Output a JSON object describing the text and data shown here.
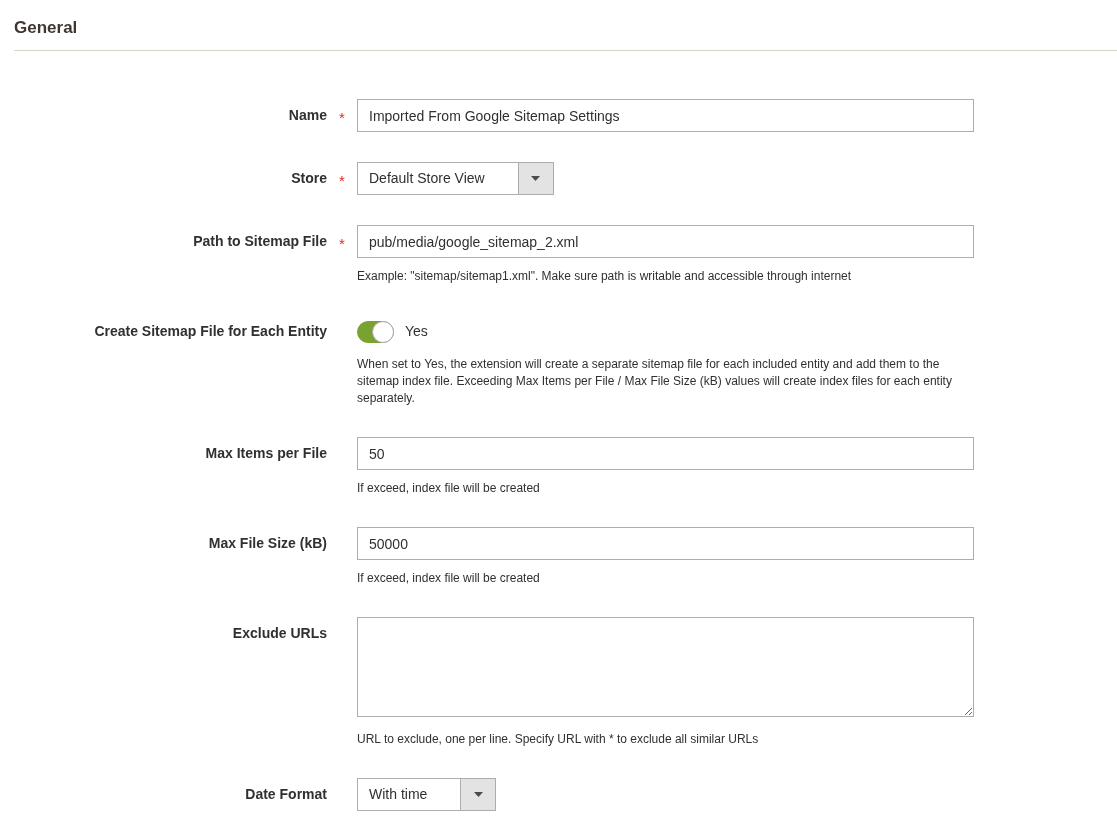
{
  "section": {
    "title": "General"
  },
  "fields": [
    {
      "kind": "text",
      "label": "Name",
      "required_mark": "*",
      "value": "Imported From Google Sitemap Settings"
    },
    {
      "kind": "select",
      "label": "Store",
      "required_mark": "*",
      "value": "Default Store View"
    },
    {
      "kind": "text",
      "label": "Path to Sitemap File",
      "required_mark": "*",
      "value": "pub/media/google_sitemap_2.xml",
      "note": "Example: \"sitemap/sitemap1.xml\". Make sure path is writable and accessible through internet"
    },
    {
      "kind": "toggle",
      "label": "Create Sitemap File for Each Entity",
      "on": true,
      "value": "Yes",
      "note": "When set to Yes, the extension will create a separate sitemap file for each included entity and add them to the sitemap index file. Exceeding Max Items per File / Max File Size (kB) values will create index files for each entity separately."
    },
    {
      "kind": "text",
      "label": "Max Items per File",
      "value": "50",
      "note": "If exceed, index file will be created"
    },
    {
      "kind": "text",
      "label": "Max File Size (kB)",
      "value": "50000",
      "note": "If exceed, index file will be created"
    },
    {
      "kind": "textarea",
      "label": "Exclude URLs",
      "note": "URL to exclude, one per line. Specify URL with * to exclude all similar URLs"
    },
    {
      "kind": "select",
      "label": "Date Format",
      "value": "With time"
    }
  ]
}
